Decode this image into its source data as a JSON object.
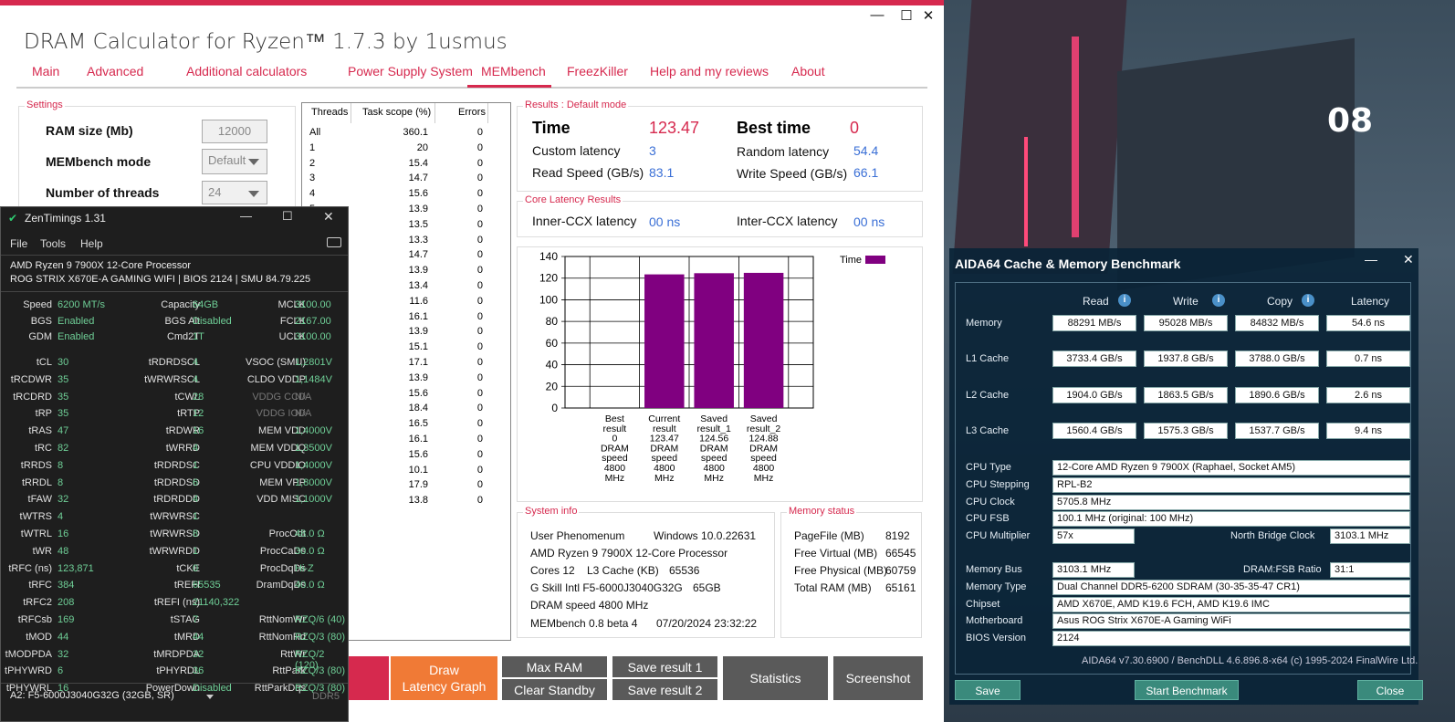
{
  "dram": {
    "title": "DRAM Calculator for Ryzen™ 1.7.3 by 1usmus",
    "tabs": [
      "Main",
      "Advanced",
      "Additional calculators",
      "Power Supply System",
      "MEMbench",
      "FreezKiller",
      "Help and my reviews",
      "About"
    ],
    "active_tab": "MEMbench",
    "settings": {
      "group": "Settings",
      "ram_size_label": "RAM size (Mb)",
      "ram_size_value": "12000",
      "mode_label": "MEMbench mode",
      "mode_value": "Default",
      "threads_label": "Number of threads",
      "threads_value": "24"
    },
    "threads_table": {
      "headers": [
        "Threads",
        "Task scope (%)",
        "Errors"
      ],
      "rows": [
        [
          "All",
          "360.1",
          "0"
        ],
        [
          "1",
          "20",
          "0"
        ],
        [
          "2",
          "15.4",
          "0"
        ],
        [
          "3",
          "14.7",
          "0"
        ],
        [
          "4",
          "15.6",
          "0"
        ],
        [
          "5",
          "13.9",
          "0"
        ],
        [
          "",
          "13.5",
          "0"
        ],
        [
          "",
          "13.3",
          "0"
        ],
        [
          "",
          "14.7",
          "0"
        ],
        [
          "",
          "13.9",
          "0"
        ],
        [
          "",
          "13.4",
          "0"
        ],
        [
          "",
          "11.6",
          "0"
        ],
        [
          "",
          "16.1",
          "0"
        ],
        [
          "",
          "13.9",
          "0"
        ],
        [
          "",
          "15.1",
          "0"
        ],
        [
          "",
          "17.1",
          "0"
        ],
        [
          "",
          "13.9",
          "0"
        ],
        [
          "",
          "15.6",
          "0"
        ],
        [
          "",
          "18.4",
          "0"
        ],
        [
          "",
          "16.5",
          "0"
        ],
        [
          "",
          "16.1",
          "0"
        ],
        [
          "",
          "15.6",
          "0"
        ],
        [
          "",
          "10.1",
          "0"
        ],
        [
          "",
          "17.9",
          "0"
        ],
        [
          "",
          "13.8",
          "0"
        ]
      ]
    },
    "results": {
      "group": "Results : Default mode",
      "time_label": "Time",
      "time_value": "123.47",
      "best_label": "Best time",
      "best_value": "0",
      "custom_label": "Custom latency",
      "custom_value": "3",
      "random_label": "Random latency",
      "random_value": "54.4",
      "read_label": "Read Speed (GB/s)",
      "read_value": "83.1",
      "write_label": "Write Speed (GB/s)",
      "write_value": "66.1"
    },
    "core_latency": {
      "group": "Core Latency Results",
      "inner_label": "Inner-CCX latency",
      "inner_value": "00 ns",
      "inter_label": "Inter-CCX latency",
      "inter_value": "00 ns"
    },
    "system_info": {
      "group": "System info",
      "user_label": "User Phenomenum",
      "os": "Windows 10.0.22631",
      "cpu": "AMD Ryzen 9 7900X 12-Core Processor",
      "cores": "Cores 12",
      "l3_label": "L3 Cache (KB)",
      "l3_value": "65536",
      "mem": "G Skill Intl F5-6000J3040G32G",
      "mem_size": "65GB",
      "dram_speed": "DRAM speed 4800 MHz",
      "version": "MEMbench 0.8 beta 4",
      "date": "07/20/2024 23:32:22"
    },
    "memory_status": {
      "group": "Memory status",
      "rows": [
        [
          "PageFile (MB)",
          "8192"
        ],
        [
          "Free Virtual (MB)",
          "66545"
        ],
        [
          "Free Physical (MB)",
          "60759"
        ],
        [
          "Total RAM (MB)",
          "65161"
        ]
      ]
    },
    "buttons": {
      "draw": "Draw\nLatency Graph",
      "max_ram": "Max RAM",
      "clear_standby": "Clear Standby",
      "save1": "Save result 1",
      "save2": "Save result 2",
      "statistics": "Statistics",
      "screenshot": "Screenshot"
    },
    "accent": "#d6294e"
  },
  "chart_data": {
    "type": "bar",
    "categories": [
      [
        "Best",
        "result",
        "0",
        "DRAM",
        "speed",
        "4800",
        "MHz"
      ],
      [
        "Current",
        "result",
        "123.47",
        "DRAM",
        "speed",
        "4800",
        "MHz"
      ],
      [
        "Saved",
        "result_1",
        "124.56",
        "DRAM",
        "speed",
        "4800",
        "MHz"
      ],
      [
        "Saved",
        "result_2",
        "124.88",
        "DRAM",
        "speed",
        "4800",
        "MHz"
      ]
    ],
    "series": [
      {
        "name": "Time",
        "values": [
          0,
          123.47,
          124.56,
          124.88
        ],
        "color": "#800080"
      }
    ],
    "yticks": [
      "140",
      "120",
      "100",
      "80",
      "60",
      "40",
      "20",
      "0"
    ],
    "ylim": [
      0,
      140
    ],
    "legend": "top-right"
  },
  "zen": {
    "title": "ZenTimings 1.31",
    "menu": [
      "File",
      "Tools",
      "Help"
    ],
    "cpu": "AMD Ryzen 9 7900X 12-Core Processor",
    "board": "ROG STRIX X670E-A GAMING WIFI | BIOS 2124 | SMU 84.79.225",
    "top": [
      [
        "Speed",
        "6200 MT/s",
        "Capacity",
        "64GB",
        "MCLK",
        "3100.00"
      ],
      [
        "BGS",
        "Enabled",
        "BGS Alt",
        "Disabled",
        "FCLK",
        "2167.00"
      ],
      [
        "GDM",
        "Enabled",
        "Cmd2T",
        "1T",
        "UCLK",
        "3100.00"
      ]
    ],
    "timings": [
      [
        "tCL",
        "30",
        "tRDRDSCL",
        "4",
        "VSOC (SMU)",
        "1,2801V"
      ],
      [
        "tRCDWR",
        "35",
        "tWRWRSCL",
        "4",
        "CLDO VDDP",
        "1,1484V"
      ],
      [
        "tRCDRD",
        "35",
        "tCWL",
        "28",
        "VDDG CCD",
        "N/A"
      ],
      [
        "tRP",
        "35",
        "tRTP",
        "12",
        "VDDG IOD",
        "N/A"
      ],
      [
        "tRAS",
        "47",
        "tRDWR",
        "16",
        "MEM VDD",
        "1,4000V"
      ],
      [
        "tRC",
        "82",
        "tWRRD",
        "4",
        "MEM VDDQ",
        "1,3500V"
      ],
      [
        "tRRDS",
        "8",
        "tRDRDSC",
        "1",
        "CPU VDDIO",
        "1,4000V"
      ],
      [
        "tRRDL",
        "8",
        "tRDRDSD",
        "6",
        "MEM VPP",
        "1,8000V"
      ],
      [
        "tFAW",
        "32",
        "tRDRDDD",
        "4",
        "VDD MISC",
        "1,1000V"
      ],
      [
        "tWTRS",
        "4",
        "tWRWRSC",
        "1",
        "",
        ""
      ],
      [
        "tWTRL",
        "16",
        "tWRWRSD",
        "8",
        "ProcOdt",
        "48.0 Ω"
      ],
      [
        "tWR",
        "48",
        "tWRWRDD",
        "1",
        "ProcCaDs",
        "30.0 Ω"
      ],
      [
        "tRFC (ns)",
        "123,871",
        "tCKE",
        "0",
        "ProcDqDs",
        "Hi-Z"
      ],
      [
        "tRFC",
        "384",
        "tREFI",
        "65535",
        "DramDqDs",
        "40.0 Ω"
      ],
      [
        "tRFC2",
        "208",
        "tREFI (ns)",
        "21140,322",
        "",
        ""
      ],
      [
        "tRFCsb",
        "169",
        "tSTAG",
        "7",
        "RttNomWr",
        "RZQ/6 (40)"
      ],
      [
        "tMOD",
        "44",
        "tMRD",
        "44",
        "RttNomRd",
        "RZQ/3 (80)"
      ],
      [
        "tMODPDA",
        "32",
        "tMRDPDA",
        "32",
        "RttWr",
        "RZQ/2 (120)"
      ],
      [
        "tPHYWRD",
        "6",
        "tPHYRDL",
        "36",
        "RttPark",
        "RZQ/3 (80)"
      ],
      [
        "tPHYWRL",
        "16",
        "PowerDown",
        "Disabled",
        "RttParkDqs",
        "RZQ/3 (80)"
      ]
    ],
    "module": "A2: F5-6000J3040G32G (32GB, SR)",
    "ddr": "DDR5"
  },
  "aida": {
    "title": "AIDA64 Cache & Memory Benchmark",
    "headers": [
      "Read",
      "Write",
      "Copy",
      "Latency"
    ],
    "rows": [
      [
        "Memory",
        "88291 MB/s",
        "95028 MB/s",
        "84832 MB/s",
        "54.6 ns"
      ],
      [
        "L1 Cache",
        "3733.4 GB/s",
        "1937.8 GB/s",
        "3788.0 GB/s",
        "0.7 ns"
      ],
      [
        "L2 Cache",
        "1904.0 GB/s",
        "1863.5 GB/s",
        "1890.6 GB/s",
        "2.6 ns"
      ],
      [
        "L3 Cache",
        "1560.4 GB/s",
        "1575.3 GB/s",
        "1537.7 GB/s",
        "9.4 ns"
      ]
    ],
    "cpu_type_label": "CPU Type",
    "cpu_type": "12-Core AMD Ryzen 9 7900X  (Raphael, Socket AM5)",
    "cpu_stepping_label": "CPU Stepping",
    "cpu_stepping": "RPL-B2",
    "cpu_clock_label": "CPU Clock",
    "cpu_clock": "5705.8 MHz",
    "cpu_fsb_label": "CPU FSB",
    "cpu_fsb": "100.1 MHz  (original: 100 MHz)",
    "cpu_mult_label": "CPU Multiplier",
    "cpu_mult": "57x",
    "nb_label": "North Bridge Clock",
    "nb_value": "3103.1 MHz",
    "mem_bus_label": "Memory Bus",
    "mem_bus": "3103.1 MHz",
    "ratio_label": "DRAM:FSB Ratio",
    "ratio_value": "31:1",
    "mem_type_label": "Memory Type",
    "mem_type": "Dual Channel DDR5-6200 SDRAM  (30-35-35-47 CR1)",
    "chipset_label": "Chipset",
    "chipset": "AMD X670E, AMD K19.6 FCH, AMD K19.6 IMC",
    "mobo_label": "Motherboard",
    "mobo": "Asus ROG Strix X670E-A Gaming WiFi",
    "bios_label": "BIOS Version",
    "bios": "2124",
    "footer": "AIDA64 v7.30.6900 / BenchDLL 4.6.896.8-x64  (c) 1995-2024 FinalWire Ltd.",
    "save": "Save",
    "start": "Start Benchmark",
    "close": "Close"
  },
  "wallpaper": {
    "sign": "08"
  }
}
